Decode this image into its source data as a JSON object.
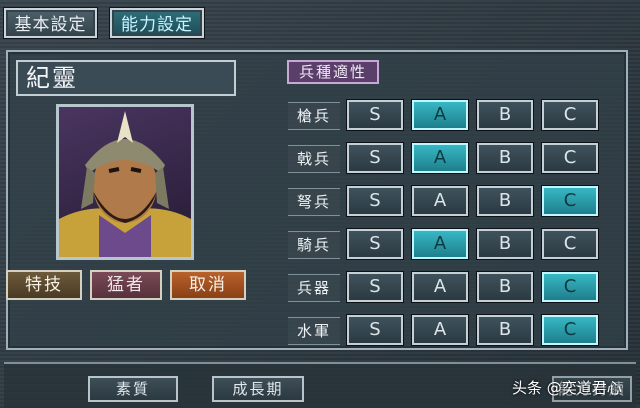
{
  "tabs": {
    "basic": "基本設定",
    "ability": "能力設定"
  },
  "character": {
    "name": "紀靈"
  },
  "skill": {
    "label": "特技",
    "value": "猛者",
    "cancel": "取消"
  },
  "aptitude": {
    "title": "兵種適性",
    "grades": [
      "S",
      "A",
      "B",
      "C"
    ],
    "rows": [
      {
        "label": "槍兵",
        "selected": "A"
      },
      {
        "label": "戟兵",
        "selected": "A"
      },
      {
        "label": "弩兵",
        "selected": "C"
      },
      {
        "label": "騎兵",
        "selected": "A"
      },
      {
        "label": "兵器",
        "selected": "C"
      },
      {
        "label": "水軍",
        "selected": "C"
      }
    ]
  },
  "bottom": {
    "btn1": "素質",
    "btn2": "成長期",
    "btn3": "能力持續"
  },
  "watermark": "头条 @奕道君心",
  "colors": {
    "active_grade": "#37b7c4",
    "title_bg": "#5a3f6a"
  }
}
